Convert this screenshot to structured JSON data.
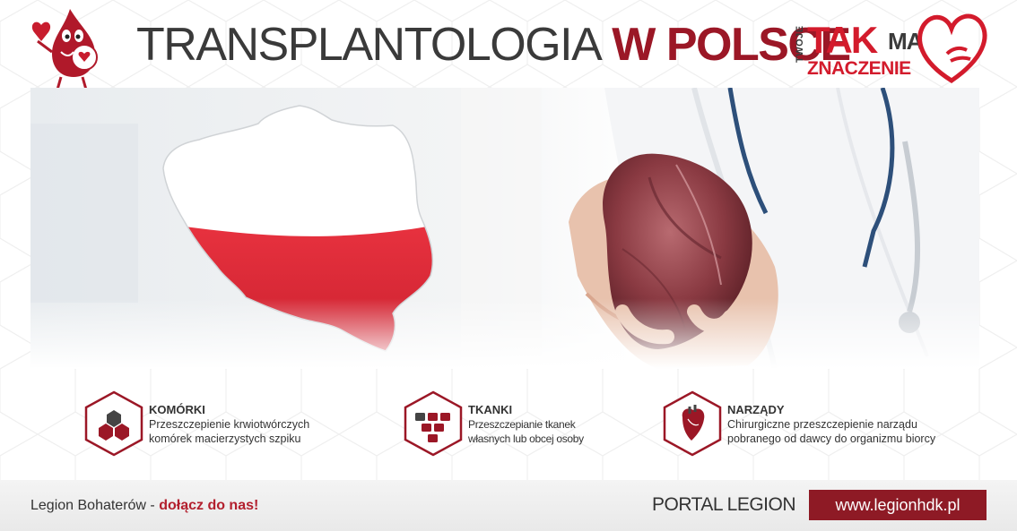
{
  "header": {
    "title_part1": "TRANSPLANTOLOGIA",
    "title_part2": "W POLSCE",
    "mascot_icon": "blood-drop-mascot-icon",
    "logo": {
      "twoje": "TWOJE",
      "tak": "TAK",
      "ma": "MA",
      "znaczenie": "ZNACZENIE",
      "icon": "heart-hand-icon"
    }
  },
  "hero": {
    "map_icon": "poland-map-flag",
    "photo_subject": "doctor-holding-heart"
  },
  "cards": [
    {
      "icon": "cells-icon",
      "title": "KOMÓRKI",
      "line1": "Przeszczepienie krwiotwórczych",
      "line2": "komórek macierzystych szpiku"
    },
    {
      "icon": "tissue-blocks-icon",
      "title": "TKANKI",
      "line1": "Przeszczepianie tkanek",
      "line2": "własnych lub obcej osoby"
    },
    {
      "icon": "heart-organ-icon",
      "title": "NARZĄDY",
      "line1": "Chirurgiczne przeszczepienie narządu",
      "line2": "pobranego od dawcy do organizmu biorcy"
    }
  ],
  "footer": {
    "left_text": "Legion Bohaterów",
    "separator": " - ",
    "join_text": "dołącz do nas!",
    "portal_label": "PORTAL LEGION",
    "url": "www.legionhdk.pl"
  },
  "colors": {
    "brand_red": "#9b1726",
    "accent_red": "#d31b2c",
    "footer_box": "#8e1a25",
    "text_dark": "#333333"
  }
}
